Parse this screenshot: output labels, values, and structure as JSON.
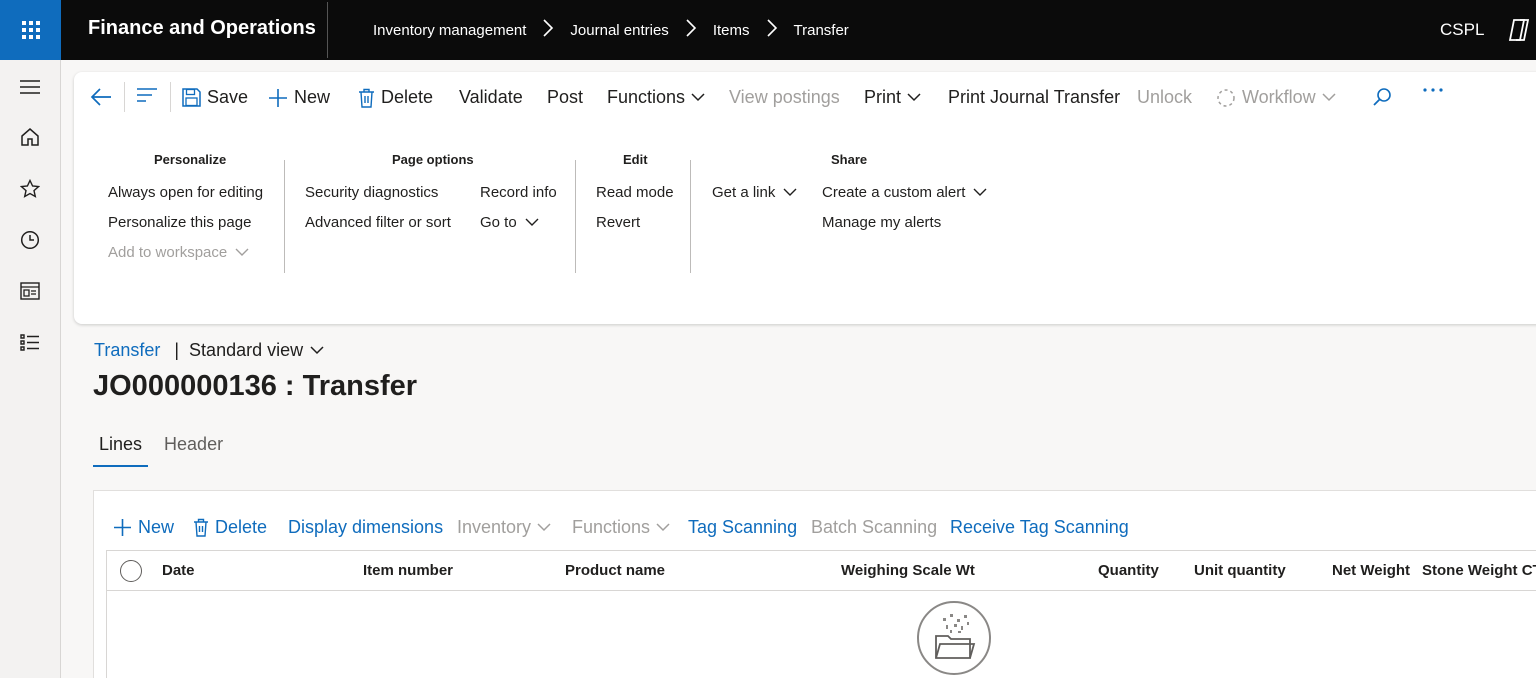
{
  "app": {
    "title": "Finance and Operations",
    "company": "CSPL"
  },
  "breadcrumb": [
    "Inventory management",
    "Journal entries",
    "Items",
    "Transfer"
  ],
  "toolbar": {
    "save": "Save",
    "new": "New",
    "delete": "Delete",
    "validate": "Validate",
    "post": "Post",
    "functions": "Functions",
    "view_postings": "View postings",
    "print": "Print",
    "print_journal_transfer": "Print Journal Transfer",
    "unlock": "Unlock",
    "workflow": "Workflow"
  },
  "options_menu": {
    "personalize": {
      "title": "Personalize",
      "items": [
        "Always open for editing",
        "Personalize this page",
        "Add to workspace"
      ]
    },
    "page_options": {
      "title": "Page options",
      "items": [
        "Security diagnostics",
        "Advanced filter or sort",
        "Record info",
        "Go to"
      ]
    },
    "edit": {
      "title": "Edit",
      "items": [
        "Read mode",
        "Revert"
      ]
    },
    "share": {
      "title": "Share",
      "items": [
        "Get a link",
        "Create a custom alert",
        "Manage my alerts"
      ]
    }
  },
  "page": {
    "crumb_link": "Transfer",
    "view": "Standard view",
    "title": "JO000000136 : Transfer",
    "tabs": [
      "Lines",
      "Header"
    ]
  },
  "lines_toolbar": {
    "new": "New",
    "delete": "Delete",
    "display_dimensions": "Display dimensions",
    "inventory": "Inventory",
    "functions": "Functions",
    "tag_scanning": "Tag Scanning",
    "batch_scanning": "Batch Scanning",
    "receive_tag_scanning": "Receive Tag Scanning"
  },
  "grid": {
    "columns": [
      "Date",
      "Item number",
      "Product name",
      "Weighing Scale Wt",
      "Quantity",
      "Unit quantity",
      "Net Weight",
      "Stone Weight CT"
    ],
    "rows": []
  },
  "colors": {
    "accent": "#0f6cbd",
    "topbar": "#0b0b0b",
    "disabled": "#a19f9d"
  }
}
